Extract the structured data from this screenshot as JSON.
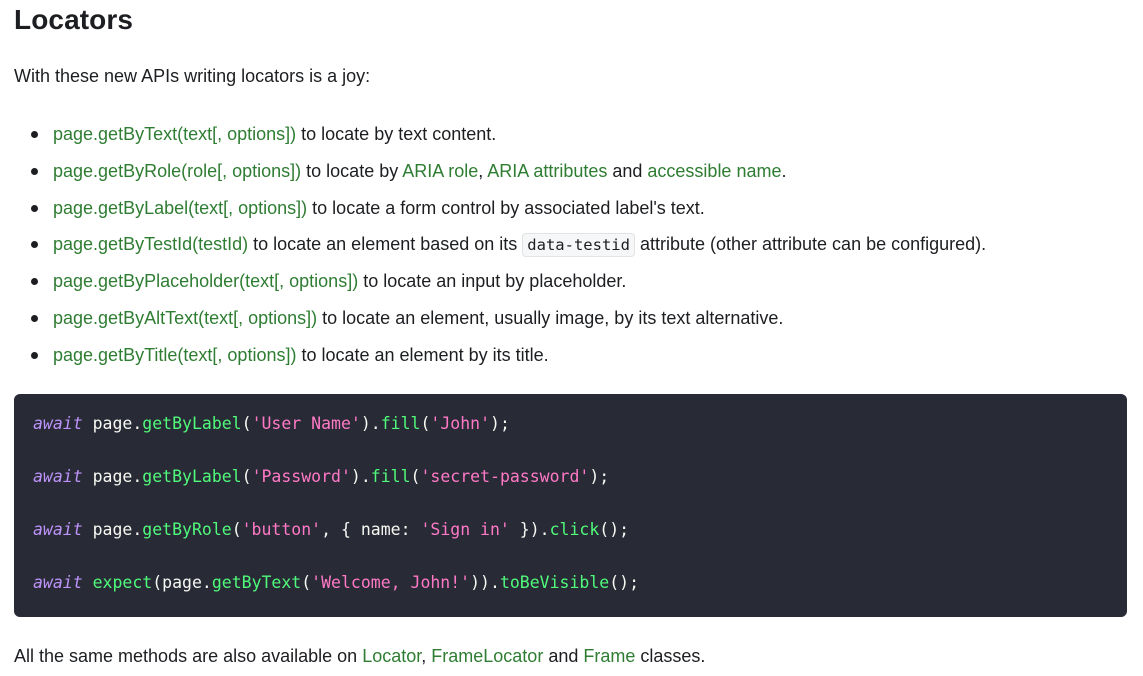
{
  "title": "Locators",
  "intro": "With these new APIs writing locators is a joy:",
  "list": [
    {
      "link": "page.getByText(text[, options])",
      "text": " to locate by text content."
    },
    {
      "link": "page.getByRole(role[, options])",
      "text_a": " to locate by ",
      "link_b": "ARIA role",
      "text_b": ", ",
      "link_c": "ARIA attributes",
      "text_c": " and ",
      "link_d": "accessible name",
      "text_d": "."
    },
    {
      "link": "page.getByLabel(text[, options])",
      "text": " to locate a form control by associated label's text."
    },
    {
      "link": "page.getByTestId(testId)",
      "text_a": " to locate an element based on its ",
      "code": "data-testid",
      "text_b": " attribute (other attribute can be configured)."
    },
    {
      "link": "page.getByPlaceholder(text[, options])",
      "text": " to locate an input by placeholder."
    },
    {
      "link": "page.getByAltText(text[, options])",
      "text": " to locate an element, usually image, by its text alternative."
    },
    {
      "link": "page.getByTitle(text[, options])",
      "text": " to locate an element by its title."
    }
  ],
  "code": {
    "line1": {
      "kw": "await",
      "p1": " page.",
      "f1": "getByLabel",
      "p2": "(",
      "s1": "'User Name'",
      "p3": ").",
      "f2": "fill",
      "p4": "(",
      "s2": "'John'",
      "p5": ");"
    },
    "line2": {
      "kw": "await",
      "p1": " page.",
      "f1": "getByLabel",
      "p2": "(",
      "s1": "'Password'",
      "p3": ").",
      "f2": "fill",
      "p4": "(",
      "s2": "'secret-password'",
      "p5": ");"
    },
    "line3": {
      "kw": "await",
      "p1": " page.",
      "f1": "getByRole",
      "p2": "(",
      "s1": "'button'",
      "p3": ", { name: ",
      "s2": "'Sign in'",
      "p4": " }).",
      "f2": "click",
      "p5": "();"
    },
    "line4": {
      "kw": "await",
      "p1": " ",
      "f1": "expect",
      "p2": "(page.",
      "f2": "getByText",
      "p3": "(",
      "s1": "'Welcome, John!'",
      "p4": ")).",
      "f3": "toBeVisible",
      "p5": "();"
    }
  },
  "outro": {
    "text_a": "All the same methods are also available on ",
    "link_a": "Locator",
    "text_b": ", ",
    "link_b": "FrameLocator",
    "text_c": " and ",
    "link_c": "Frame",
    "text_d": " classes."
  },
  "colors": {
    "link": "#2e7d32",
    "code_bg": "#282a36",
    "keyword": "#bd93f9",
    "function": "#50fa7b",
    "string": "#ff79c6"
  }
}
